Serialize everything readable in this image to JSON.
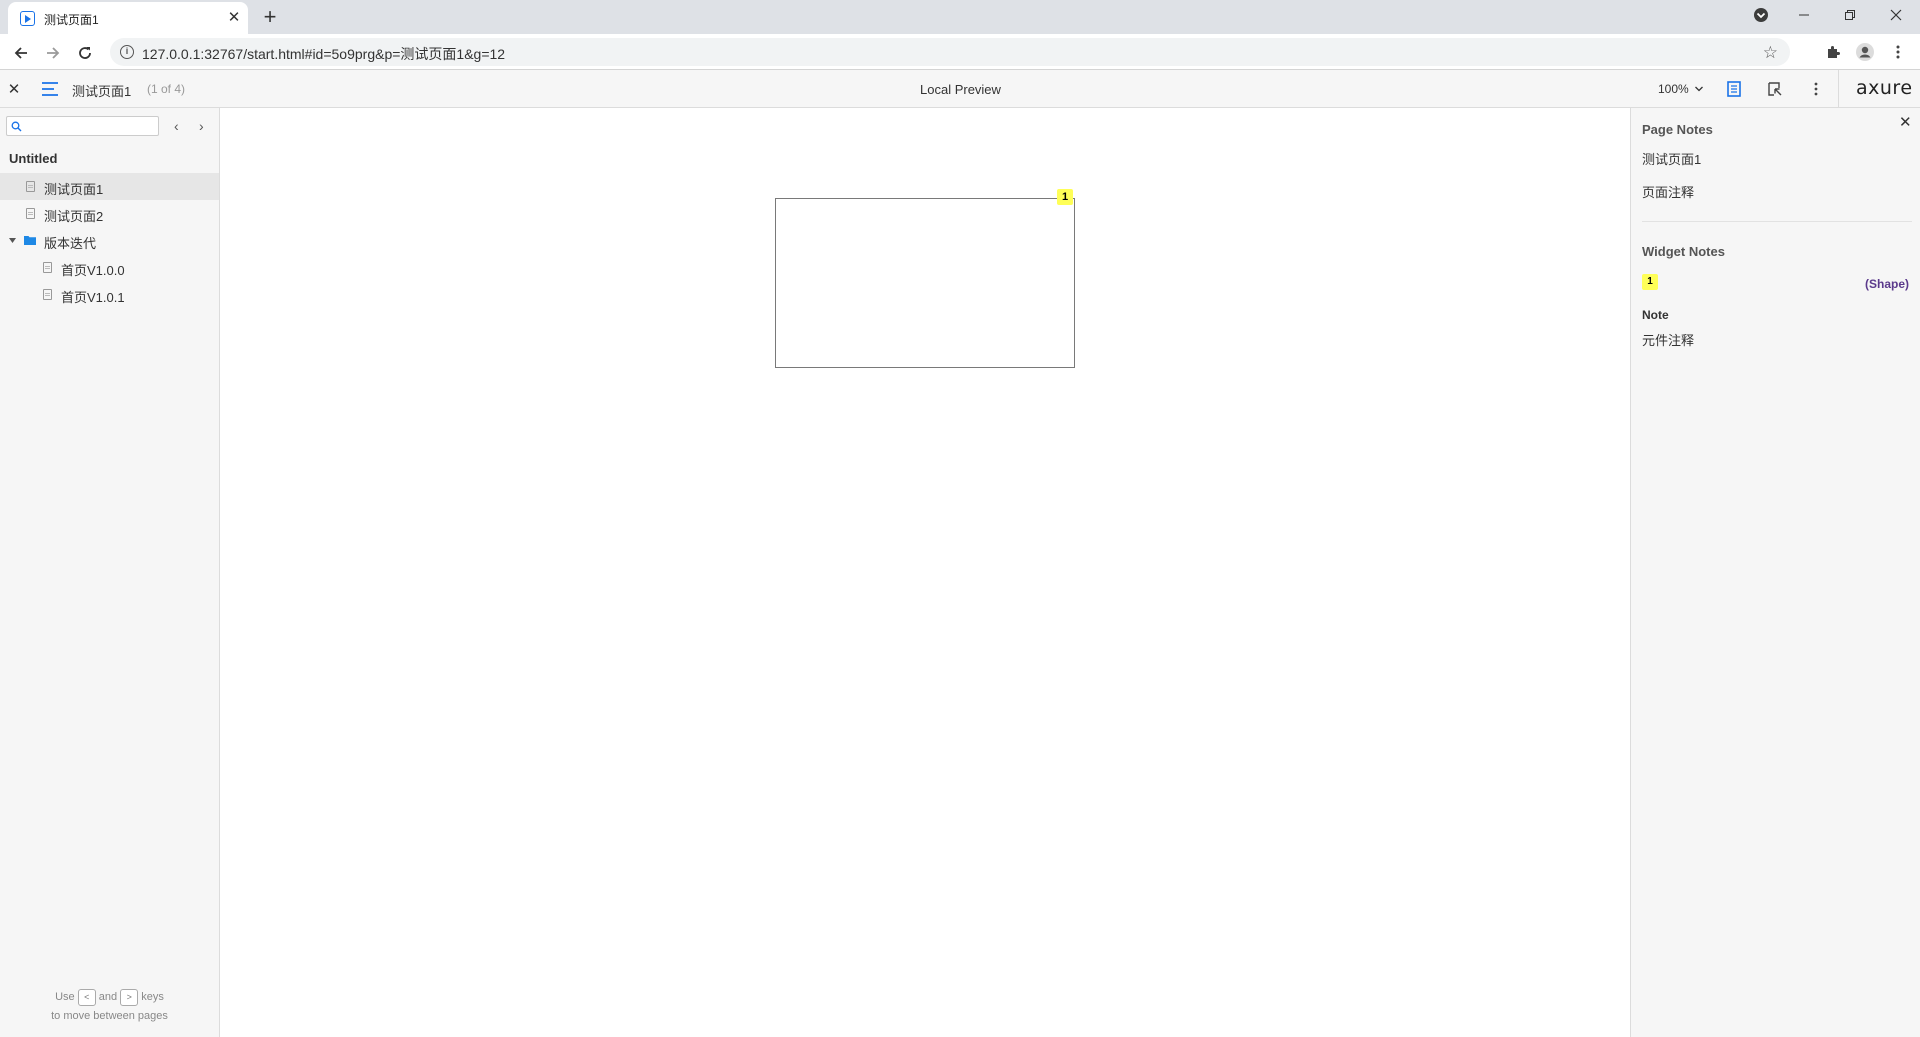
{
  "browser": {
    "tab_title": "测试页面1",
    "url": "127.0.0.1:32767/start.html#id=5o9prg&p=测试页面1&g=12"
  },
  "toolbar": {
    "page_title": "测试页面1",
    "page_count": "(1 of 4)",
    "center_label": "Local Preview",
    "zoom": "100%",
    "logo": "axure"
  },
  "sitemap": {
    "search_placeholder": "",
    "project": "Untitled",
    "items": [
      {
        "label": "测试页面1",
        "type": "page",
        "selected": true
      },
      {
        "label": "测试页面2",
        "type": "page"
      },
      {
        "label": "版本迭代",
        "type": "folder",
        "expanded": true
      },
      {
        "label": "首页V1.0.0",
        "type": "page"
      },
      {
        "label": "首页V1.0.1",
        "type": "page"
      }
    ],
    "hint": {
      "use": "Use",
      "key_prev": "<",
      "and": "and",
      "key_next": ">",
      "keys": "keys",
      "line2": "to move between pages"
    }
  },
  "canvas": {
    "badge": "1"
  },
  "notes": {
    "page_notes_heading": "Page Notes",
    "page_name": "测试页面1",
    "page_note": "页面注释",
    "widget_notes_heading": "Widget Notes",
    "widget_badge": "1",
    "widget_type": "(Shape)",
    "note_label": "Note",
    "widget_note": "元件注释"
  },
  "colors": {
    "accent_blue": "#1a73e8",
    "folder_blue": "#1e88e5",
    "badge_yellow": "#ffff57",
    "shape_type_purple": "#5b3a8c"
  },
  "icons": {
    "tab_favicon": "play-box-icon",
    "back": "arrow-left-icon",
    "forward": "arrow-right-icon",
    "reload": "reload-icon",
    "info": "info-icon",
    "bookmark": "star-icon",
    "extensions": "puzzle-icon",
    "profile": "account-icon",
    "menu": "hamburger-icon",
    "notes_toggle": "document-icon",
    "inspect": "inspect-icon"
  }
}
